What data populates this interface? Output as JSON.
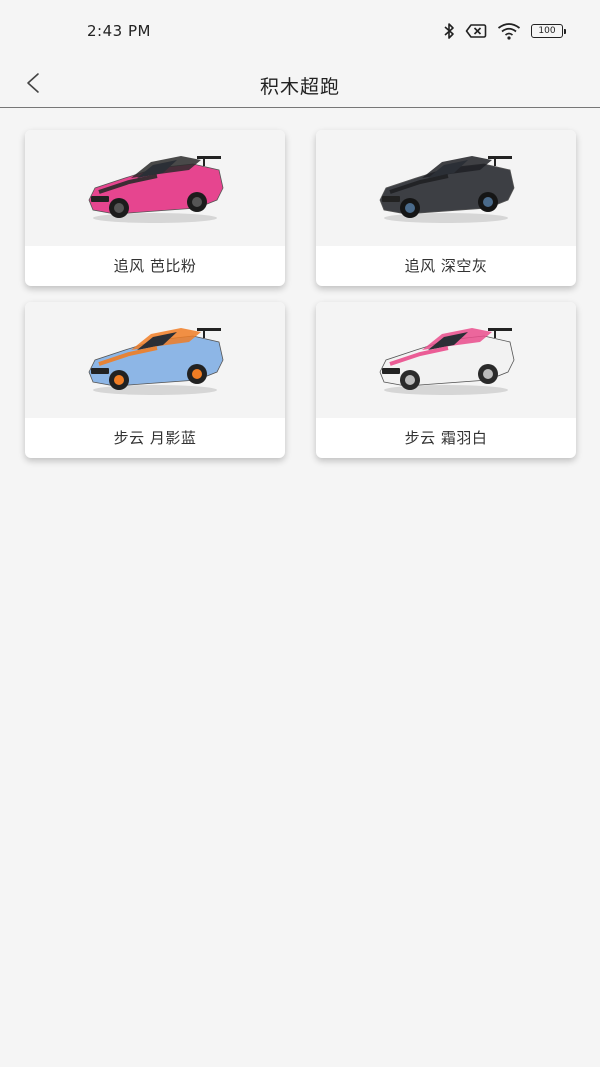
{
  "status_bar": {
    "time": "2:43 PM",
    "battery": "100",
    "icons": [
      "bluetooth-icon",
      "no-sim-icon",
      "wifi-icon",
      "battery-icon"
    ]
  },
  "header": {
    "back_icon": "chevron-left-icon",
    "title": "积木超跑"
  },
  "cars": [
    {
      "label": "追风 芭比粉",
      "body_color": "#e6458f",
      "accent_color": "#2a2a2a",
      "wheel_color": "#1c1c1c",
      "rim_color": "#555555"
    },
    {
      "label": "追风 深空灰",
      "body_color": "#3d3f44",
      "accent_color": "#1f2024",
      "wheel_color": "#151515",
      "rim_color": "#4a6a8a"
    },
    {
      "label": "步云 月影蓝",
      "body_color": "#8db6e6",
      "accent_color": "#f07d24",
      "wheel_color": "#222222",
      "rim_color": "#f07d24"
    },
    {
      "label": "步云 霜羽白",
      "body_color": "#f2f2f2",
      "accent_color": "#ea4c8c",
      "wheel_color": "#2a2a2a",
      "rim_color": "#bbbbbb"
    }
  ]
}
